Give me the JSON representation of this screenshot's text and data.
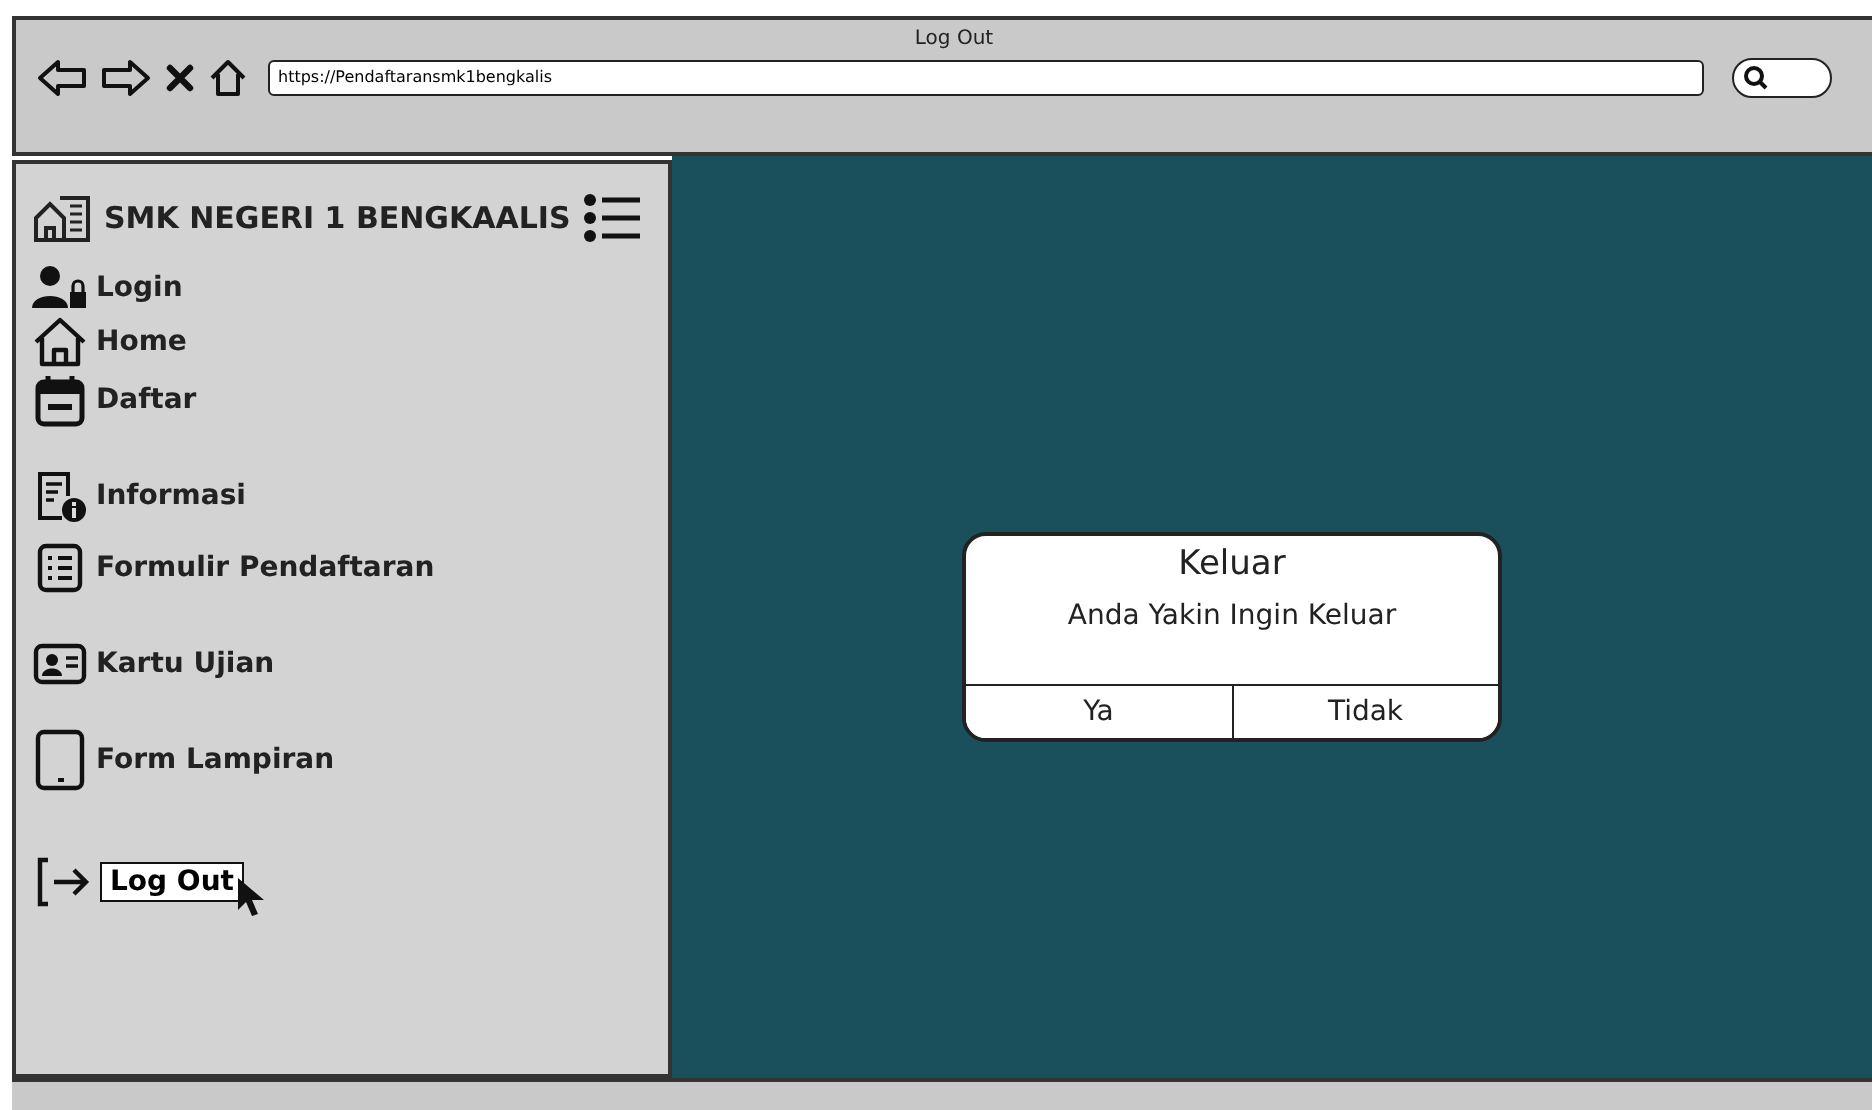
{
  "window": {
    "title": "Log Out"
  },
  "address_bar": {
    "url": "https://Pendaftaransmk1bengkalis"
  },
  "sidebar": {
    "title": "SMK NEGERI 1 BENGKAALIS",
    "items": [
      {
        "label": "Login",
        "selected": false
      },
      {
        "label": "Home",
        "selected": false
      },
      {
        "label": "Daftar",
        "selected": false
      },
      {
        "label": "Informasi",
        "selected": false
      },
      {
        "label": "Formulir Pendaftaran",
        "selected": false
      },
      {
        "label": "Kartu Ujian",
        "selected": false
      },
      {
        "label": "Form Lampiran",
        "selected": false
      },
      {
        "label": "Log Out",
        "selected": true
      }
    ]
  },
  "dialog": {
    "title": "Keluar",
    "message": "Anda Yakin Ingin Keluar",
    "buttons": [
      "Ya",
      "Tidak"
    ]
  }
}
